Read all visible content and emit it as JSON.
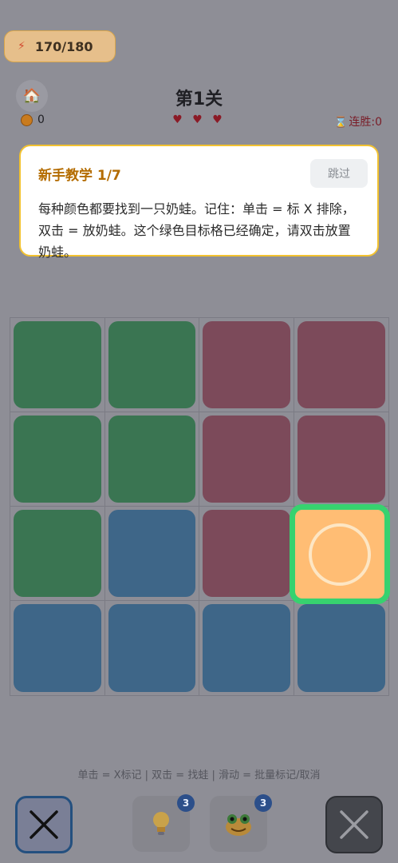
{
  "status": {
    "energy": "170/180",
    "coins": "0",
    "hearts": "♥ ♥ ♥",
    "streak": "连胜:0"
  },
  "level": {
    "title": "第1关"
  },
  "tutorial": {
    "title": "新手教学 1/7",
    "skip_label": "跳过",
    "text": "每种颜色都要找到一只奶蛙。记住：单击 = 标 X 排除，双击 = 放奶蛙。这个绿色目标格已经确定，请双击放置奶蛙。"
  },
  "board": {
    "rows": [
      [
        "green",
        "green",
        "red",
        "red"
      ],
      [
        "green",
        "green",
        "red",
        "red"
      ],
      [
        "green",
        "blue",
        "red",
        "orange"
      ],
      [
        "blue",
        "blue",
        "blue",
        "blue"
      ]
    ],
    "highlight": {
      "row": 3,
      "col": 4
    }
  },
  "hint_text": "单击 = X标记 | 双击 = 找蛙 | 滑动 = 批量标记/取消",
  "controls": {
    "hint_badge": "3",
    "frog_badge": "3"
  },
  "colors": {
    "green": "#3a7552",
    "red": "#7c4a5a",
    "blue": "#3e6688",
    "orange": "#ffbd74",
    "highlight_border": "#37d26f"
  },
  "icons": [
    "lightning-icon",
    "home-icon",
    "coin-icon",
    "heart-icon",
    "hourglass-icon",
    "x-mark-icon",
    "lightbulb-icon",
    "frog-icon"
  ]
}
